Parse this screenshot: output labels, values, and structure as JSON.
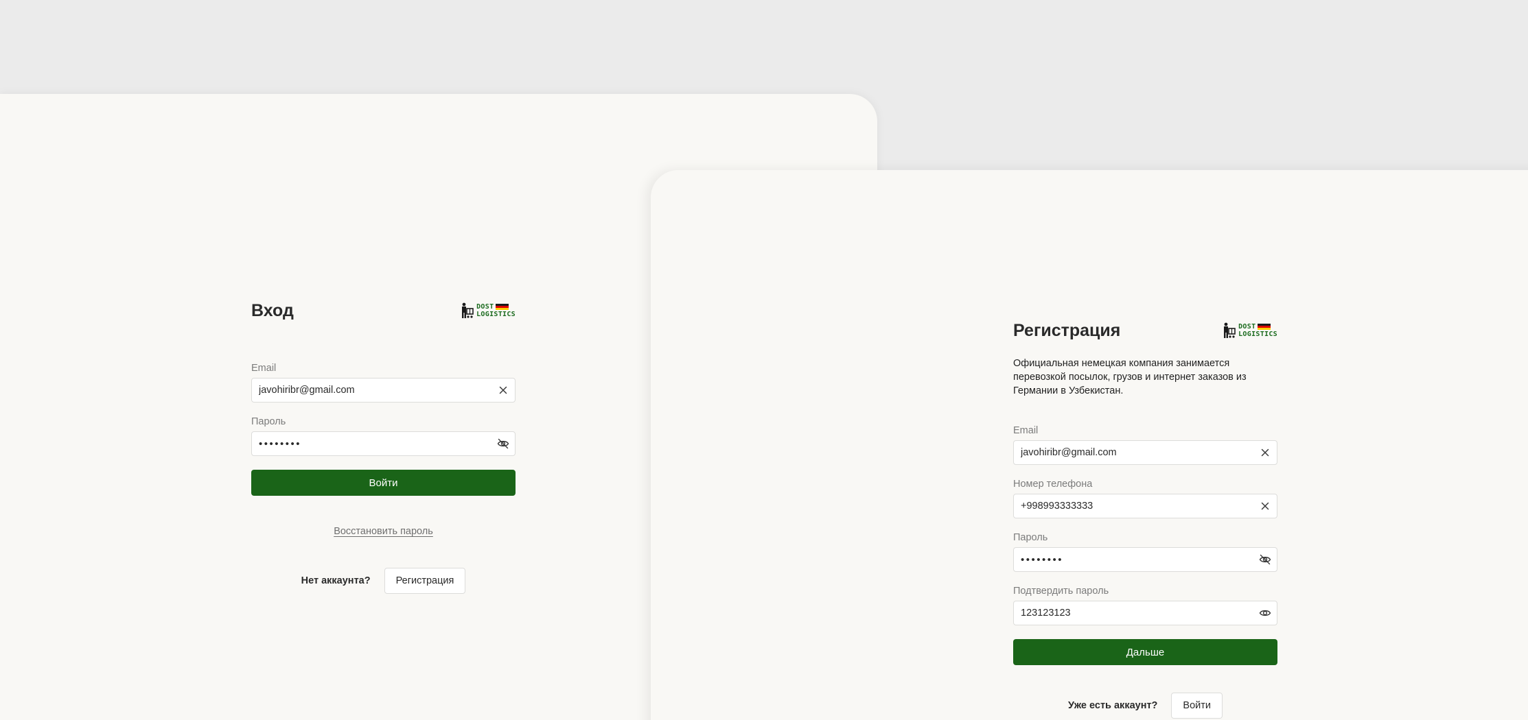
{
  "login": {
    "title": "Вход",
    "email_label": "Email",
    "email_value": "javohiribr@gmail.com",
    "email_clear_icon": "close-icon",
    "password_label": "Пароль",
    "password_value": "12345678",
    "password_toggle_icon": "eye-off-icon",
    "submit_label": "Войти",
    "forgot_link": "Восстановить пароль",
    "no_account_text": "Нет аккаунта?",
    "register_button": "Регистрация"
  },
  "register": {
    "title": "Регистрация",
    "description": "Официальная немецкая компания занимается перевозкой посылок, грузов и интернет заказов из Германии в Узбекистан.",
    "email_label": "Email",
    "email_value": "javohiribr@gmail.com",
    "phone_label": "Номер телефона",
    "phone_value": "+998993333333",
    "password_label": "Пароль",
    "password_value": "12345678",
    "confirm_label": "Подтвердить пароль",
    "confirm_value": "123123123",
    "submit_label": "Дальше",
    "have_account_text": "Уже есть аккаунт?",
    "login_button": "Войти"
  },
  "logo": {
    "line1": "DOST",
    "line2": "LOGISTICS",
    "flag_colors": [
      "#1a1a1a",
      "#dd0000",
      "#ffce00"
    ],
    "brand_color": "#1b6b1e"
  },
  "colors": {
    "background": "#ebebeb",
    "panel": "#f9f8f5",
    "primary": "#1a6418",
    "label": "#7b7b7b"
  }
}
